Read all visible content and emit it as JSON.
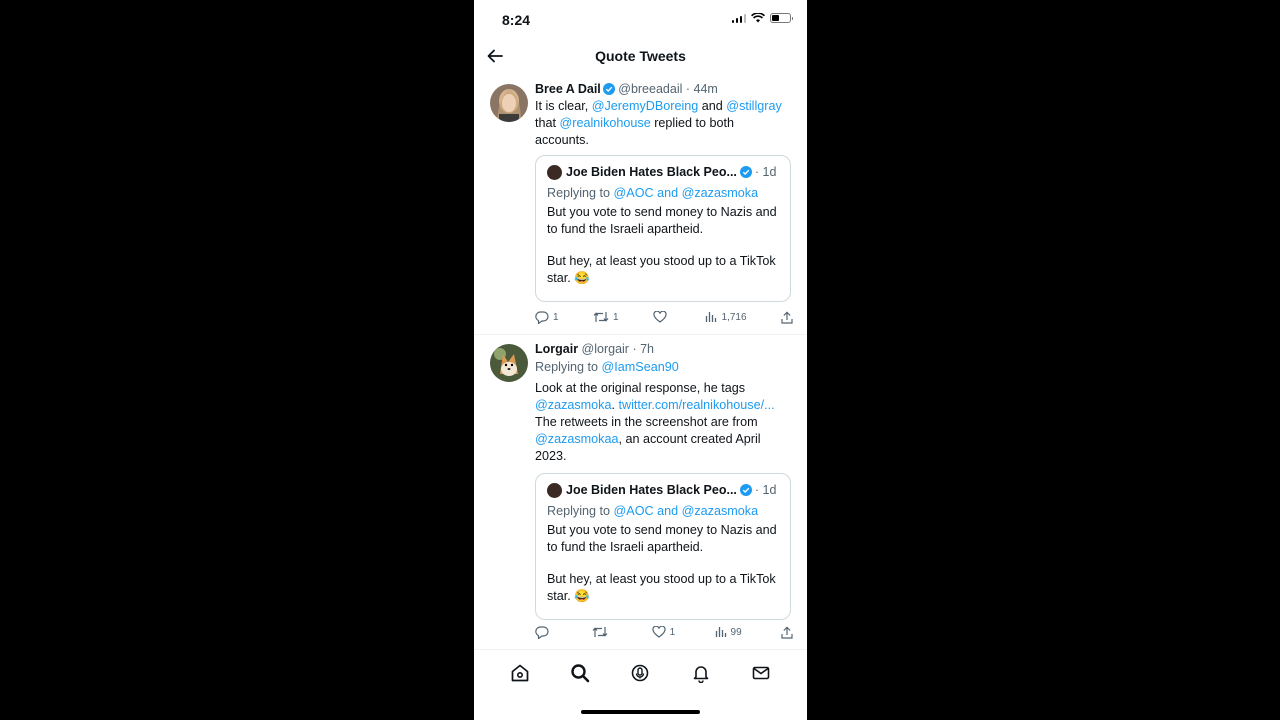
{
  "status_bar": {
    "time": "8:24"
  },
  "header": {
    "title": "Quote Tweets"
  },
  "tweets": [
    {
      "name": "Bree A Dail",
      "handle": "@breeadail",
      "time": "· 44m",
      "text_parts": [
        "It is clear, ",
        "@JeremyDBoreing",
        " and ",
        "@stillgray",
        " that ",
        "@realnikohouse",
        " replied to both accounts."
      ],
      "quote": {
        "name": "Joe Biden Hates Black Peo...",
        "time": "· 1d",
        "replying_prefix": "Replying to ",
        "replying_to": "@AOC and @zazasmoka",
        "text1": "But you vote to send money to Nazis and to fund the Israeli apartheid.",
        "text2": "But hey, at least you stood up to a TikTok star. 😂"
      },
      "actions": {
        "replies": "1",
        "retweets": "1",
        "likes": "",
        "views": "1,716"
      }
    },
    {
      "name": "Lorgair",
      "handle": "@lorgair",
      "time": "· 7h",
      "replying_prefix": "Replying to ",
      "replying_to": "@IamSean90",
      "text_parts": [
        "Look at the original response, he tags ",
        "@zazasmoka",
        ". ",
        "twitter.com/realnikohouse/...",
        " The retweets in the screenshot are from ",
        "@zazasmokaa",
        ", an account created April 2023."
      ],
      "quote": {
        "name": "Joe Biden Hates Black Peo...",
        "time": "· 1d",
        "replying_prefix": "Replying to ",
        "replying_to": "@AOC and @zazasmoka",
        "text1": "But you vote to send money to Nazis and to fund the Israeli apartheid.",
        "text2": "But hey, at least you stood up to a TikTok star. 😂"
      },
      "actions": {
        "replies": "",
        "retweets": "",
        "likes": "1",
        "views": "99"
      }
    }
  ],
  "tab_bar": {
    "items": [
      "home-icon",
      "search-icon",
      "spaces-icon",
      "notifications-icon",
      "messages-icon"
    ]
  },
  "colors": {
    "link": "#1d9bf0",
    "muted": "#536471",
    "border": "#cfd9de"
  }
}
